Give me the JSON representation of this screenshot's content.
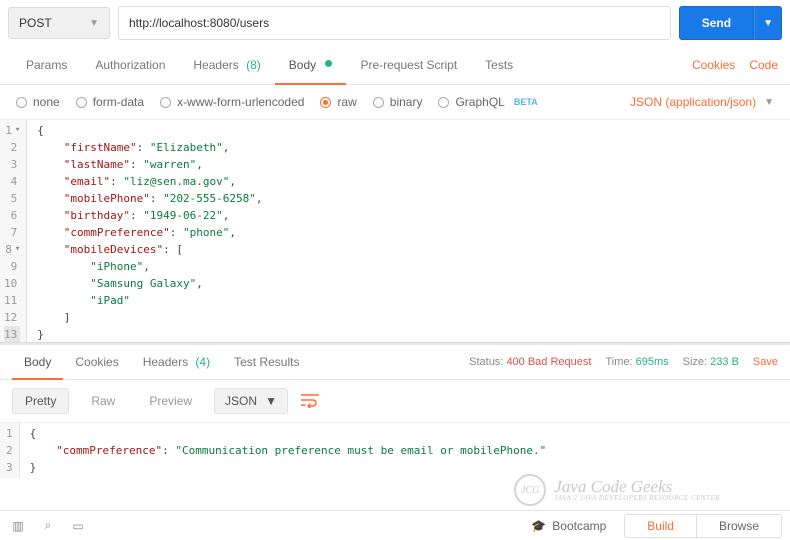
{
  "request": {
    "method": "POST",
    "url": "http://localhost:8080/users",
    "send_label": "Send"
  },
  "tabs": {
    "params": "Params",
    "authorization": "Authorization",
    "headers": "Headers",
    "headers_count": "(8)",
    "body": "Body",
    "prerequest": "Pre-request Script",
    "tests": "Tests"
  },
  "tabs_right": {
    "cookies": "Cookies",
    "code": "Code"
  },
  "body_types": {
    "none": "none",
    "formdata": "form-data",
    "xwww": "x-www-form-urlencoded",
    "raw": "raw",
    "binary": "binary",
    "graphql": "GraphQL",
    "beta": "BETA",
    "format": "JSON (application/json)"
  },
  "request_body": {
    "lines": [
      "{",
      "    \"firstName\": \"Elizabeth\",",
      "    \"lastName\": \"warren\",",
      "    \"email\": \"liz@sen.ma.gov\",",
      "    \"mobilePhone\": \"202-555-6258\",",
      "    \"birthday\": \"1949-06-22\",",
      "    \"commPreference\": \"phone\",",
      "    \"mobileDevices\": [",
      "        \"iPhone\",",
      "        \"Samsung Galaxy\",",
      "        \"iPad\"",
      "    ]",
      "}"
    ]
  },
  "response_tabs": {
    "body": "Body",
    "cookies": "Cookies",
    "headers": "Headers",
    "headers_count": "(4)",
    "test_results": "Test Results"
  },
  "response_meta": {
    "status_lbl": "Status:",
    "status_val": "400 Bad Request",
    "time_lbl": "Time:",
    "time_val": "695ms",
    "size_lbl": "Size:",
    "size_val": "233 B",
    "save": "Save"
  },
  "response_toolbar": {
    "pretty": "Pretty",
    "raw": "Raw",
    "preview": "Preview",
    "format": "JSON"
  },
  "response_body": {
    "lines": [
      "{",
      "    \"commPreference\": \"Communication preference must be email or mobilePhone.\"",
      "}"
    ]
  },
  "watermark": {
    "logo": "JCG",
    "main": "Java Code Geeks",
    "sub": "Java 2 Java Developers Resource Center"
  },
  "bottombar": {
    "bootcamp": "Bootcamp",
    "build": "Build",
    "browse": "Browse"
  }
}
